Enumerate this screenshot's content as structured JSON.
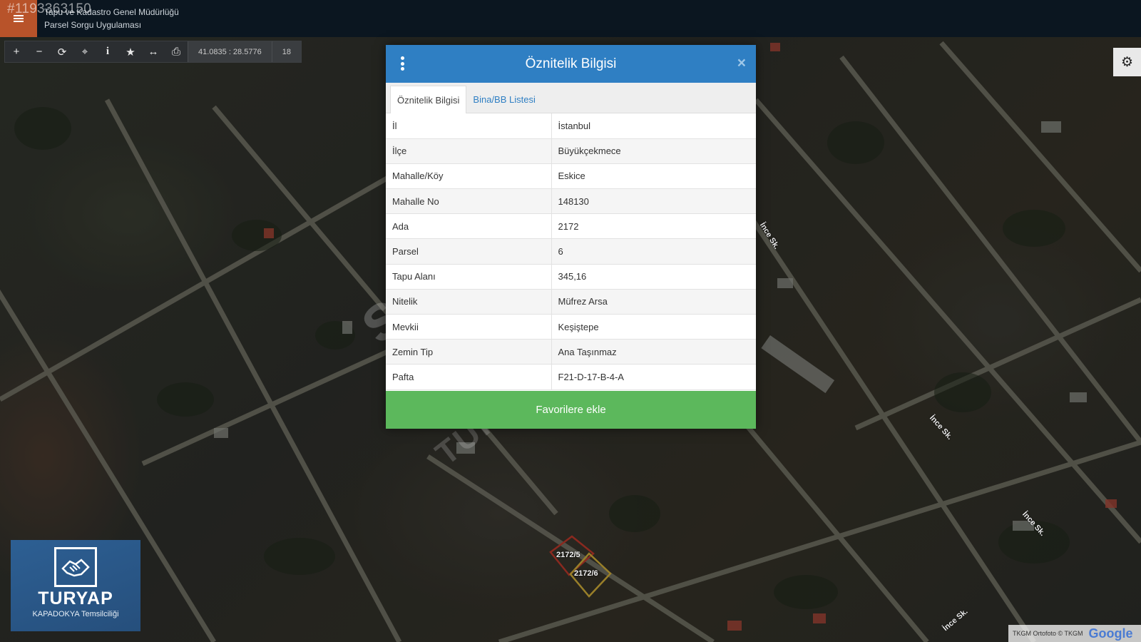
{
  "listing_id": "#1193363150",
  "app": {
    "org_name": "Tapu ve Kadastro Genel Müdürlüğü",
    "app_name": "Parsel Sorgu Uygulaması"
  },
  "toolbar": {
    "tools": [
      {
        "name": "zoom-in",
        "glyph": "+"
      },
      {
        "name": "zoom-out",
        "glyph": "−"
      },
      {
        "name": "refresh",
        "glyph": "⟳"
      },
      {
        "name": "locate",
        "glyph": "⌖"
      },
      {
        "name": "info",
        "glyph": "i"
      },
      {
        "name": "favorites",
        "glyph": "★"
      },
      {
        "name": "measure",
        "glyph": "↔"
      },
      {
        "name": "print",
        "glyph": "⎙"
      }
    ],
    "coordinates": "41.0835 : 28.5776",
    "zoom_level": "18"
  },
  "modal": {
    "title": "Öznitelik Bilgisi",
    "close_glyph": "×",
    "tabs": [
      {
        "label": "Öznitelik Bilgisi",
        "active": true
      },
      {
        "label": "Bina/BB Listesi",
        "active": false
      }
    ],
    "rows": [
      {
        "key": "İl",
        "value": "İstanbul"
      },
      {
        "key": "İlçe",
        "value": "Büyükçekmece"
      },
      {
        "key": "Mahalle/Köy",
        "value": "Eskice"
      },
      {
        "key": "Mahalle No",
        "value": "148130"
      },
      {
        "key": "Ada",
        "value": "2172"
      },
      {
        "key": "Parsel",
        "value": "6"
      },
      {
        "key": "Tapu Alanı",
        "value": "345,16"
      },
      {
        "key": "Nitelik",
        "value": "Müfrez Arsa"
      },
      {
        "key": "Mevkii",
        "value": "Keşiştepe"
      },
      {
        "key": "Zemin Tip",
        "value": "Ana Taşınmaz"
      },
      {
        "key": "Pafta",
        "value": "F21-D-17-B-4-A"
      }
    ],
    "favorite_button": "Favorilere ekle"
  },
  "map": {
    "parcels": [
      "2172/5",
      "2172/6"
    ],
    "streets": [
      "İnce Sk.",
      "İnce Sk.",
      "İnce Sk.",
      "İnce Sk."
    ],
    "watermark_main": "satılık",
    "watermark_sub": "TURYAP",
    "attribution": "TKGM Ortofoto © TKGM",
    "attribution_brand": "Google"
  },
  "logo": {
    "name": "TURYAP",
    "branch": "KAPADOKYA Temsilciliği"
  },
  "colors": {
    "header_blue": "#2f7fc3",
    "favorite_green": "#5cb85c",
    "menu_orange": "#b8532a",
    "topbar": "#0b1620",
    "parcel_selected": "#d4b13a",
    "parcel_other": "#c0392b"
  }
}
